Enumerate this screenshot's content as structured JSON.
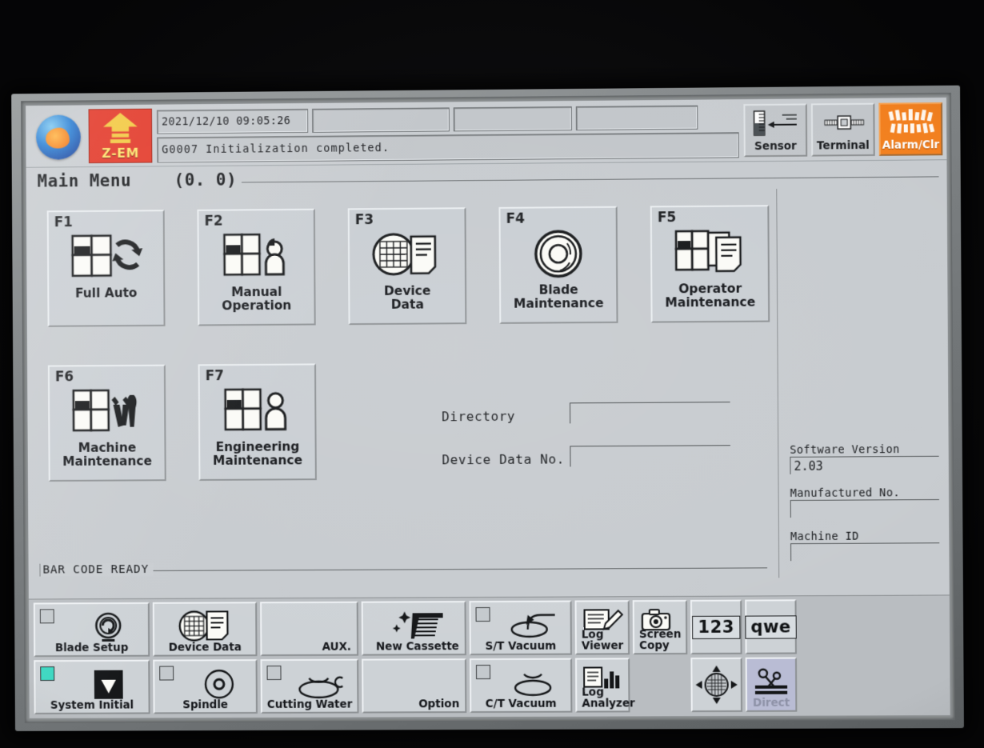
{
  "header": {
    "logo_icon": "company-sphere-logo",
    "zem": {
      "label": "Z-EM",
      "icon": "up-arrow-icon"
    },
    "datetime": "2021/12/10 09:05:26",
    "field_b": "",
    "field_c": "",
    "field_d": "",
    "message": "G0007   Initialization completed.",
    "buttons": [
      {
        "label": "Sensor",
        "icon": "sensor-gauge-icon"
      },
      {
        "label": "Terminal",
        "icon": "chip-terminal-icon"
      },
      {
        "label": "Alarm/Clr",
        "icon": "alarm-bars-icon"
      }
    ]
  },
  "page": {
    "title": "Main Menu",
    "coordinate": "(0. 0)"
  },
  "function_buttons": [
    {
      "key": "F1",
      "label": "Full Auto",
      "icon": "wafer-auto-cycle-icon"
    },
    {
      "key": "F2",
      "label": "Manual\nOperation",
      "icon": "wafer-operator-icon"
    },
    {
      "key": "F3",
      "label": "Device\nData",
      "icon": "wafer-document-icon"
    },
    {
      "key": "F4",
      "label": "Blade\nMaintenance",
      "icon": "blade-disc-icon"
    },
    {
      "key": "F5",
      "label": "Operator\nMaintenance",
      "icon": "wafer-docs-icon"
    },
    {
      "key": "F6",
      "label": "Machine\nMaintenance",
      "icon": "wafer-tools-icon"
    },
    {
      "key": "F7",
      "label": "Engineering\nMaintenance",
      "icon": "wafer-engineer-icon"
    }
  ],
  "form": {
    "directory": {
      "label": "Directory",
      "value": ""
    },
    "device_data_no": {
      "label": "Device Data No.",
      "value": ""
    }
  },
  "status": {
    "barcode": "BAR CODE READY"
  },
  "info_panel": {
    "software_version": {
      "label": "Software Version",
      "value": "2.03"
    },
    "manufactured_no": {
      "label": "Manufactured No.",
      "value": ""
    },
    "machine_id": {
      "label": "Machine ID",
      "value": ""
    }
  },
  "toolbar": [
    {
      "label": "Blade Setup",
      "icon": "blade-setup-icon",
      "checkbox": "off"
    },
    {
      "label": "System Initial",
      "icon": "system-initial-icon",
      "checkbox": "on"
    },
    {
      "label": "Device Data",
      "icon": "device-data-icon",
      "checkbox": "none"
    },
    {
      "label": "Spindle",
      "icon": "spindle-icon",
      "checkbox": "off"
    },
    {
      "label": "AUX.",
      "icon": "none",
      "checkbox": "none"
    },
    {
      "label": "Cutting Water",
      "icon": "cutting-water-icon",
      "checkbox": "off"
    },
    {
      "label": "New Cassette",
      "icon": "new-cassette-icon",
      "checkbox": "none"
    },
    {
      "label": "Option",
      "icon": "none",
      "checkbox": "none"
    },
    {
      "label": "S/T Vacuum",
      "icon": "st-vacuum-icon",
      "checkbox": "off"
    },
    {
      "label": "C/T Vacuum",
      "icon": "ct-vacuum-icon",
      "checkbox": "off"
    },
    {
      "label": "Log\nViewer",
      "icon": "log-viewer-icon",
      "checkbox": "none"
    },
    {
      "label": "Log\nAnalyzer",
      "icon": "log-analyzer-icon",
      "checkbox": "none"
    },
    {
      "label": "Screen\nCopy",
      "icon": "camera-icon",
      "checkbox": "none"
    },
    {
      "label": "Direct",
      "icon": "direct-cut-icon",
      "checkbox": "none"
    }
  ],
  "keypads": {
    "numeric": "123",
    "alpha": "qwe",
    "dpad_icon": "dpad-navigation-icon"
  },
  "colors": {
    "screen_bg": "#c7cbcf",
    "button_face": "#c9ced3",
    "alarm_orange": "#f2801f",
    "zem_red": "#e23323",
    "checkbox_on_teal": "#39d6c0",
    "direct_lavender": "#b9bcd4"
  }
}
